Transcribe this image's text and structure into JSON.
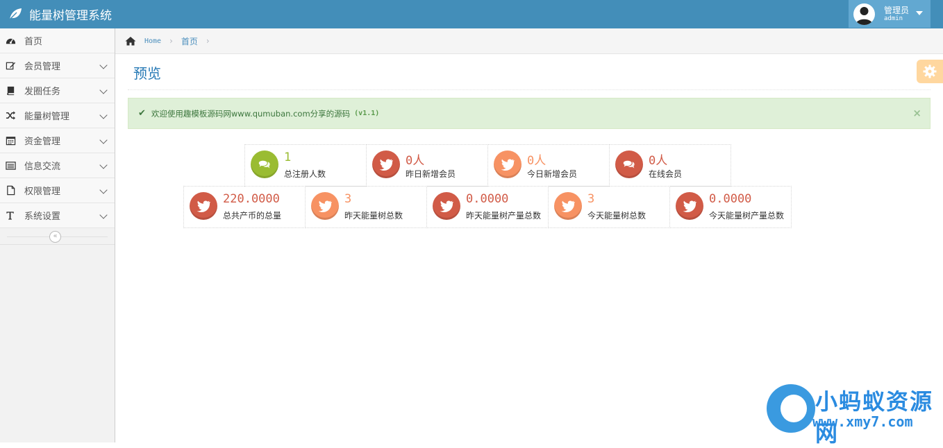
{
  "app": {
    "title": "能量树管理系统"
  },
  "user": {
    "role": "管理员",
    "name": "admin"
  },
  "sidebar": {
    "items": [
      {
        "label": "首页",
        "icon": "tachometer-icon"
      },
      {
        "label": "会员管理",
        "icon": "edit-icon"
      },
      {
        "label": "发圈任务",
        "icon": "book-icon"
      },
      {
        "label": "能量树管理",
        "icon": "random-icon"
      },
      {
        "label": "资金管理",
        "icon": "calendar-icon"
      },
      {
        "label": "信息交流",
        "icon": "list-alt-icon"
      },
      {
        "label": "权限管理",
        "icon": "file-icon"
      },
      {
        "label": "系统设置",
        "icon": "text-height-icon"
      }
    ],
    "collapse": "«"
  },
  "breadcrumb": {
    "home": "Home",
    "current": "首页"
  },
  "page": {
    "title": "预览"
  },
  "alert": {
    "text": "欢迎使用趣模板源码网www.qumuban.com分享的源码",
    "version": "(v1.1)",
    "close": "×"
  },
  "stats_row1": [
    {
      "value": "1",
      "label": "总注册人数",
      "color": "#9abc32",
      "icon": "comments-icon"
    },
    {
      "value": "0人",
      "label": "昨日新增会员",
      "color": "#d15b47",
      "icon": "twitter-icon"
    },
    {
      "value": "0人",
      "label": "今日新增会员",
      "color": "#f79263",
      "icon": "twitter-icon"
    },
    {
      "value": "0人",
      "label": "在线会员",
      "color": "#d15b47",
      "icon": "comments-icon"
    }
  ],
  "stats_row2": [
    {
      "value": "220.0000",
      "label": "总共产币的总量",
      "color": "#d15b47",
      "icon": "twitter-icon"
    },
    {
      "value": "3",
      "label": "昨天能量树总数",
      "color": "#f79263",
      "icon": "twitter-icon"
    },
    {
      "value": "0.0000",
      "label": "昨天能量树产量总数",
      "color": "#d15b47",
      "icon": "twitter-icon"
    },
    {
      "value": "3",
      "label": "今天能量树总数",
      "color": "#f79263",
      "icon": "twitter-icon"
    },
    {
      "value": "0.0000",
      "label": "今天能量树产量总数",
      "color": "#d15b47",
      "icon": "twitter-icon"
    }
  ],
  "watermark": {
    "title": "小蚂蚁资源网",
    "url": "www.xmy7.com"
  }
}
